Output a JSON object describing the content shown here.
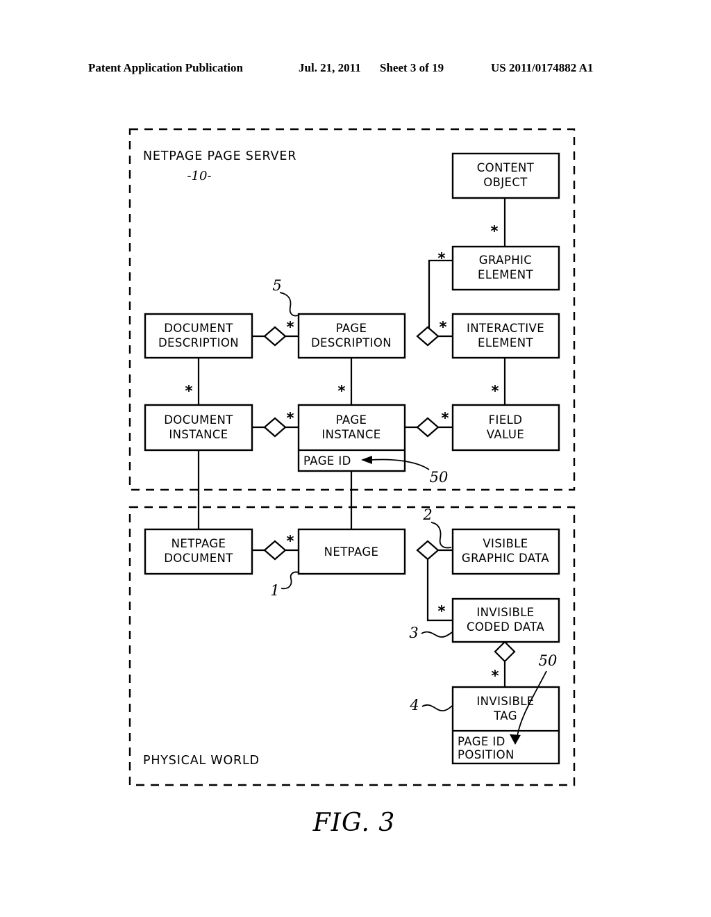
{
  "header": {
    "publication": "Patent Application Publication",
    "date": "Jul. 21, 2011",
    "sheet": "Sheet 3 of 19",
    "number": "US 2011/0174882 A1"
  },
  "figure": {
    "caption": "FIG. 3"
  },
  "regions": [
    {
      "id": "netpage-page-server",
      "label": "NETPAGE PAGE SERVER",
      "ref": "-10-"
    },
    {
      "id": "physical-world",
      "label": "PHYSICAL WORLD",
      "ref": ""
    }
  ],
  "boxes": [
    {
      "id": "content-object",
      "lines": [
        "CONTENT",
        "OBJECT"
      ]
    },
    {
      "id": "graphic-element",
      "lines": [
        "GRAPHIC",
        "ELEMENT"
      ]
    },
    {
      "id": "interactive-element",
      "lines": [
        "INTERACTIVE",
        "ELEMENT"
      ]
    },
    {
      "id": "document-description",
      "lines": [
        "DOCUMENT",
        "DESCRIPTION"
      ]
    },
    {
      "id": "page-description",
      "lines": [
        "PAGE",
        "DESCRIPTION"
      ]
    },
    {
      "id": "document-instance",
      "lines": [
        "DOCUMENT",
        "INSTANCE"
      ]
    },
    {
      "id": "page-instance",
      "lines": [
        "PAGE",
        "INSTANCE"
      ],
      "compartment": [
        "PAGE ID"
      ]
    },
    {
      "id": "field-value",
      "lines": [
        "FIELD",
        "VALUE"
      ]
    },
    {
      "id": "netpage-document",
      "lines": [
        "NETPAGE",
        "DOCUMENT"
      ]
    },
    {
      "id": "netpage",
      "lines": [
        "NETPAGE"
      ]
    },
    {
      "id": "visible-graphic-data",
      "lines": [
        "VISIBLE",
        "GRAPHIC DATA"
      ]
    },
    {
      "id": "invisible-coded-data",
      "lines": [
        "INVISIBLE",
        "CODED DATA"
      ]
    },
    {
      "id": "invisible-tag",
      "lines": [
        "INVISIBLE",
        "TAG"
      ],
      "compartment": [
        "PAGE ID",
        "POSITION"
      ]
    }
  ],
  "reference_numerals": [
    {
      "id": "ref-5",
      "value": "5"
    },
    {
      "id": "ref-50-top",
      "value": "50"
    },
    {
      "id": "ref-1",
      "value": "1"
    },
    {
      "id": "ref-2",
      "value": "2"
    },
    {
      "id": "ref-3",
      "value": "3"
    },
    {
      "id": "ref-4",
      "value": "4"
    },
    {
      "id": "ref-50-bottom",
      "value": "50"
    }
  ],
  "multiplicities": {
    "symbol": "*",
    "markers": [
      "content-object-to-graphic-element",
      "graphic-element-to-page-description",
      "page-description-to-document-description",
      "interactive-element-to-page-description",
      "document-description-to-document-instance",
      "page-description-to-page-instance",
      "interactive-element-to-field-value",
      "page-instance-to-document-instance",
      "field-value-to-page-instance",
      "netpage-to-netpage-document",
      "invisible-coded-data-to-netpage",
      "invisible-tag-to-invisible-coded-data"
    ]
  },
  "colors": {
    "ink": "#000000",
    "paper": "#ffffff"
  }
}
